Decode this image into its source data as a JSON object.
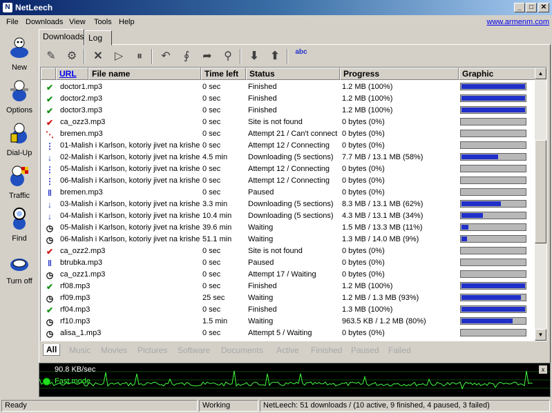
{
  "window": {
    "title": "NetLeech",
    "minimize": "_",
    "maximize": "□",
    "close": "✕"
  },
  "menu": [
    "File",
    "Downloads",
    "View",
    "Tools",
    "Help"
  ],
  "website": "www.armenm.com",
  "sidebar": [
    {
      "label": "New",
      "icon": "new-download-icon"
    },
    {
      "label": "Options",
      "icon": "options-icon"
    },
    {
      "label": "Dial-Up",
      "icon": "dialup-icon"
    },
    {
      "label": "Traffic",
      "icon": "traffic-icon"
    },
    {
      "label": "Find",
      "icon": "find-icon"
    },
    {
      "label": "Turn off",
      "icon": "turn-off-icon"
    }
  ],
  "tabs": [
    "Downloads",
    "Log"
  ],
  "toolbar": {
    "spell_icon_text": "abc"
  },
  "columns": {
    "url": "URL",
    "file": "File name",
    "time": "Time left",
    "status": "Status",
    "progress": "Progress",
    "graphic": "Graphic"
  },
  "rows": [
    {
      "icon": "check",
      "file": "doctor1.mp3",
      "time": "0 sec",
      "status": "Finished",
      "progress": "1.2 MB (100%)",
      "pct": 1.0
    },
    {
      "icon": "check",
      "file": "doctor2.mp3",
      "time": "0 sec",
      "status": "Finished",
      "progress": "1.2 MB (100%)",
      "pct": 1.0
    },
    {
      "icon": "check",
      "file": "doctor3.mp3",
      "time": "0 sec",
      "status": "Finished",
      "progress": "1.2 MB (100%)",
      "pct": 1.0
    },
    {
      "icon": "redcheck",
      "file": "ca_ozz3.mp3",
      "time": "0 sec",
      "status": "Site is not found",
      "progress": "0 bytes (0%)",
      "pct": 0
    },
    {
      "icon": "connect-fail",
      "file": "bremen.mp3",
      "time": "0 sec",
      "status": "Attempt 21 / Can't connect",
      "progress": "0 bytes (0%)",
      "pct": 0
    },
    {
      "icon": "connecting",
      "file": "01-Malish i Karlson, kotoriy jivet na krishe...",
      "time": "0 sec",
      "status": "Attempt 12 / Connecting",
      "progress": "0 bytes (0%)",
      "pct": 0
    },
    {
      "icon": "down",
      "file": "02-Malish i Karlson, kotoriy jivet na krishe...",
      "time": "4.5 min",
      "status": "Downloading (5 sections)",
      "progress": "7.7 MB / 13.1 MB (58%)",
      "pct": 0.58
    },
    {
      "icon": "connecting",
      "file": "05-Malish i Karlson, kotoriy jivet na krishe...",
      "time": "0 sec",
      "status": "Attempt 12 / Connecting",
      "progress": "0 bytes (0%)",
      "pct": 0
    },
    {
      "icon": "connecting",
      "file": "06-Malish i Karlson, kotoriy jivet na krishe...",
      "time": "0 sec",
      "status": "Attempt 12 / Connecting",
      "progress": "0 bytes (0%)",
      "pct": 0
    },
    {
      "icon": "pause",
      "file": "bremen.mp3",
      "time": "0 sec",
      "status": "Paused",
      "progress": "0 bytes (0%)",
      "pct": 0
    },
    {
      "icon": "down",
      "file": "03-Malish i Karlson, kotoriy jivet na krishe...",
      "time": "3.3 min",
      "status": "Downloading (5 sections)",
      "progress": "8.3 MB / 13.1 MB (62%)",
      "pct": 0.62
    },
    {
      "icon": "down",
      "file": "04-Malish i Karlson, kotoriy jivet na krishe...",
      "time": "10.4 min",
      "status": "Downloading (5 sections)",
      "progress": "4.3 MB / 13.1 MB (34%)",
      "pct": 0.34
    },
    {
      "icon": "clock",
      "file": "05-Malish i Karlson, kotoriy jivet na krishe...",
      "time": "39.6 min",
      "status": "Waiting",
      "progress": "1.5 MB / 13.3 MB (11%)",
      "pct": 0.11
    },
    {
      "icon": "clock",
      "file": "06-Malish i Karlson, kotoriy jivet na krishe...",
      "time": "51.1 min",
      "status": "Waiting",
      "progress": "1.3 MB / 14.0 MB (9%)",
      "pct": 0.09
    },
    {
      "icon": "redcheck",
      "file": "ca_ozz2.mp3",
      "time": "0 sec",
      "status": "Site is not found",
      "progress": "0 bytes (0%)",
      "pct": 0
    },
    {
      "icon": "pause",
      "file": "btrubka.mp3",
      "time": "0 sec",
      "status": "Paused",
      "progress": "0 bytes (0%)",
      "pct": 0
    },
    {
      "icon": "clock",
      "file": "ca_ozz1.mp3",
      "time": "0 sec",
      "status": "Attempt 17 / Waiting",
      "progress": "0 bytes (0%)",
      "pct": 0
    },
    {
      "icon": "check",
      "file": "rf08.mp3",
      "time": "0 sec",
      "status": "Finished",
      "progress": "1.2 MB (100%)",
      "pct": 1.0
    },
    {
      "icon": "clock",
      "file": "rf09.mp3",
      "time": "25 sec",
      "status": "Waiting",
      "progress": "1.2 MB / 1.3 MB (93%)",
      "pct": 0.93
    },
    {
      "icon": "check",
      "file": "rf04.mp3",
      "time": "0 sec",
      "status": "Finished",
      "progress": "1.3 MB (100%)",
      "pct": 1.0
    },
    {
      "icon": "clock",
      "file": "rf10.mp3",
      "time": "1.5 min",
      "status": "Waiting",
      "progress": "963.5 KB / 1.2 MB (80%)",
      "pct": 0.8
    },
    {
      "icon": "clock",
      "file": "alisa_1.mp3",
      "time": "0 sec",
      "status": "Attempt 5 / Waiting",
      "progress": "0 bytes (0%)",
      "pct": 0
    }
  ],
  "filter_tabs": [
    "All",
    "Music",
    "Movies",
    "Pictures",
    "Software",
    "Documents",
    "Active",
    "Finished",
    "Paused",
    "Failed"
  ],
  "graph": {
    "speed": "90.8 KB/sec",
    "mode": "Fast mode",
    "close": "x"
  },
  "status": {
    "ready": "Ready",
    "working": "Working",
    "summary": "NetLeech: 51 downloads / (10 active, 9 finished, 4 paused, 3 failed)"
  },
  "colors": {
    "bar": "#2030c8",
    "graph_line": "#40ff40",
    "titlebar": "#0a246a"
  }
}
